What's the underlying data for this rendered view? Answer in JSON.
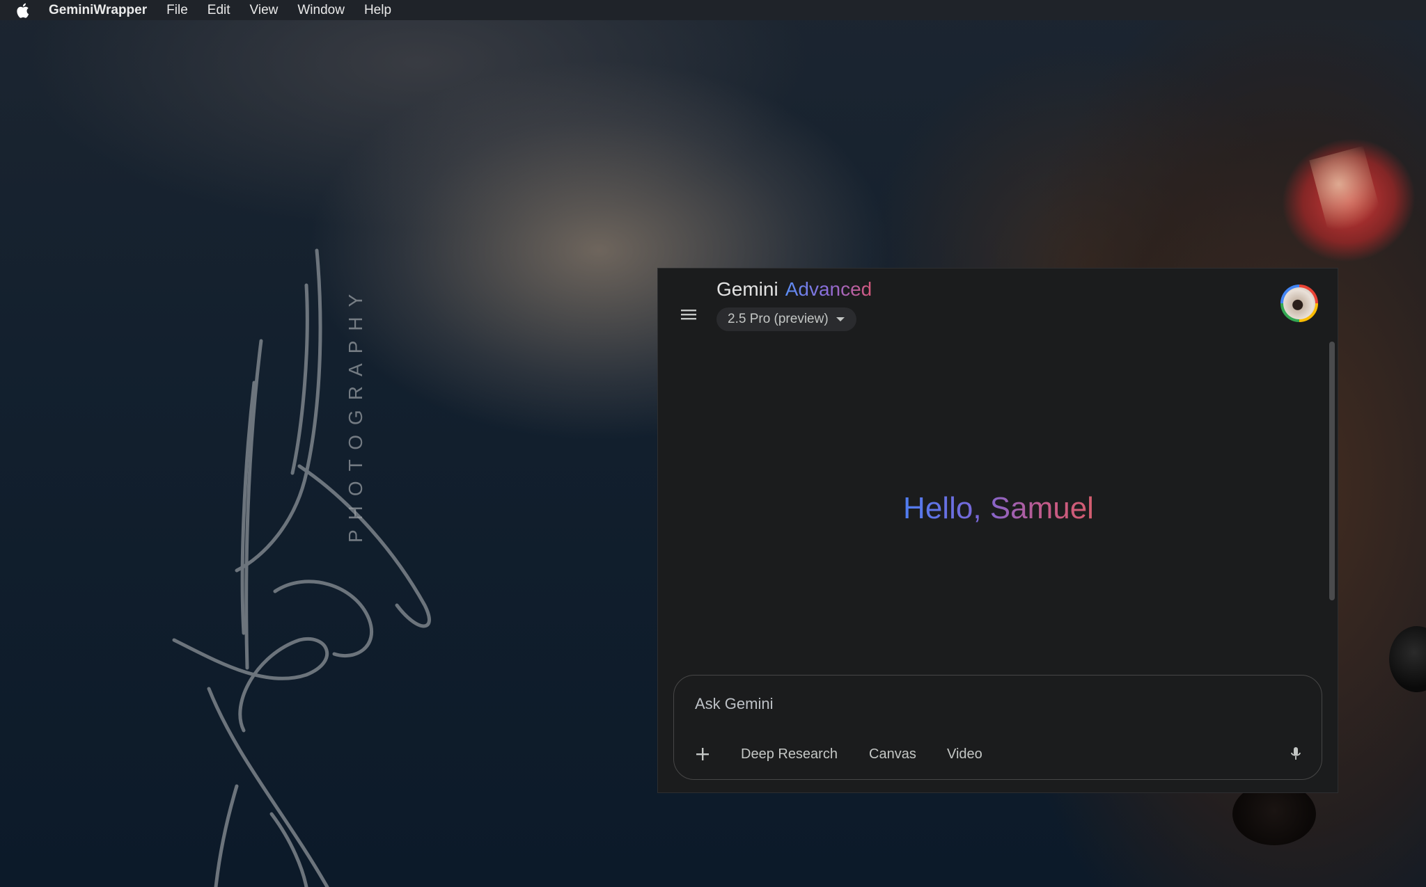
{
  "menubar": {
    "app_name": "GeminiWrapper",
    "items": [
      "File",
      "Edit",
      "View",
      "Window",
      "Help"
    ]
  },
  "wallpaper": {
    "photo_word": "PHOTOGRAPHY"
  },
  "gemini": {
    "title": "Gemini",
    "title_accent": "Advanced",
    "model": "2.5 Pro (preview)",
    "greeting": "Hello, Samuel",
    "input_placeholder": "Ask Gemini",
    "tools": [
      "Deep Research",
      "Canvas",
      "Video"
    ]
  },
  "colors": {
    "window_bg": "#1b1c1d",
    "accent_blue": "#4f7df0",
    "accent_pink": "#d35d6e"
  }
}
